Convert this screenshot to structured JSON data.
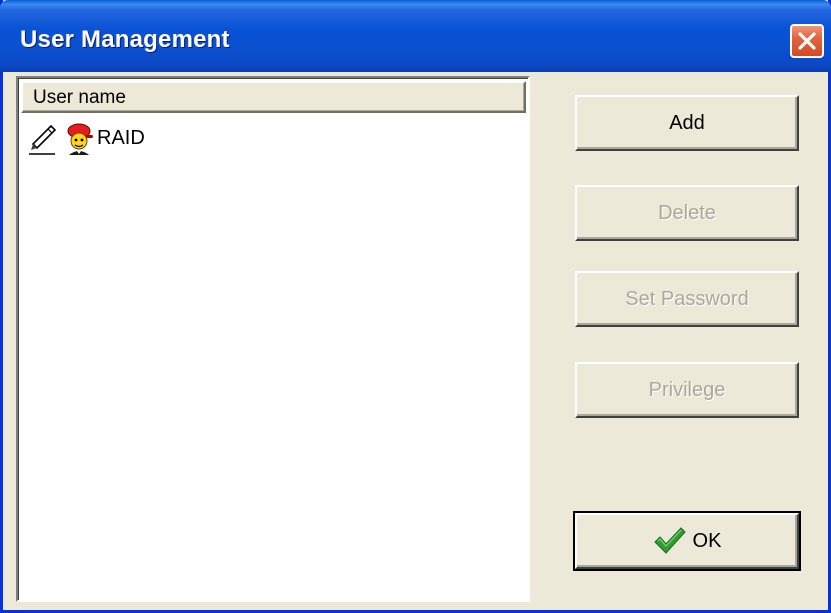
{
  "window": {
    "title": "User Management"
  },
  "list": {
    "column_header": "User name",
    "rows": [
      {
        "name": "RAID",
        "icons": [
          "pen-edit-icon",
          "user-cap-icon"
        ]
      }
    ]
  },
  "buttons": {
    "add_label": "Add",
    "delete_label": "Delete",
    "set_password_label": "Set Password",
    "privilege_label": "Privilege",
    "ok_label": "OK"
  },
  "colors": {
    "titlebar": "#0A53D6",
    "close_button": "#D24B22",
    "dialog_bg": "#ECE9D8",
    "disabled_text": "#ACA899",
    "ok_check": "#2E9E2E"
  }
}
